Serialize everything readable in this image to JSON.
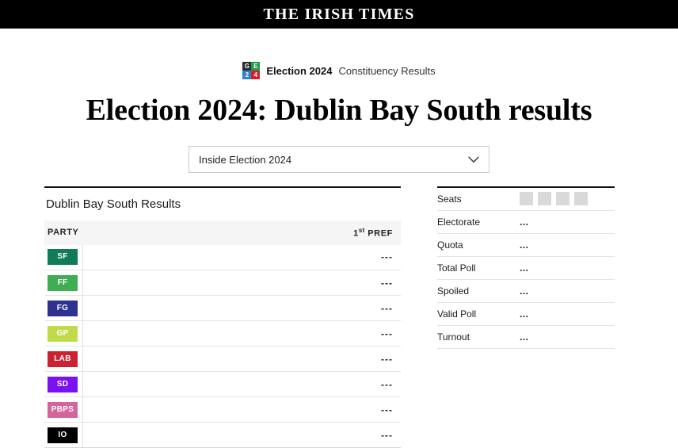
{
  "masthead": {
    "title": "THE IRISH TIMES"
  },
  "eyebrow": {
    "logo": {
      "name": "ge24-logo",
      "cells": [
        {
          "text": "G",
          "color": "#2b2b2b"
        },
        {
          "text": "E",
          "color": "#1f9d4d"
        },
        {
          "text": "2",
          "color": "#2b7fd4"
        },
        {
          "text": "4",
          "color": "#d4202c"
        }
      ]
    },
    "strong": "Election 2024",
    "light": "Constituency Results"
  },
  "page_title": "Election 2024: Dublin Bay South results",
  "selector": {
    "value": "Inside Election 2024",
    "icon": "chevron-down-icon"
  },
  "results": {
    "heading": "Dublin Bay South Results",
    "columns": {
      "party": "PARTY",
      "pref_number": "1",
      "pref_suffix": "st",
      "pref_label": "PREF"
    },
    "rows": [
      {
        "party": "SF",
        "color": "#0f7b57",
        "value": "---",
        "bar_pct": 0
      },
      {
        "party": "FF",
        "color": "#3fae52",
        "value": "---",
        "bar_pct": 0
      },
      {
        "party": "FG",
        "color": "#2f3191",
        "value": "---",
        "bar_pct": 0
      },
      {
        "party": "GP",
        "color": "#c2d94a",
        "value": "---",
        "bar_pct": 0
      },
      {
        "party": "LAB",
        "color": "#cc2131",
        "value": "---",
        "bar_pct": 0
      },
      {
        "party": "SD",
        "color": "#7b10f0",
        "value": "---",
        "bar_pct": 0
      },
      {
        "party": "PBPS",
        "color": "#d4649b",
        "value": "---",
        "bar_pct": 0
      },
      {
        "party": "IO",
        "color": "#000000",
        "value": "---",
        "bar_pct": 0
      }
    ]
  },
  "stats": {
    "rows": [
      {
        "label": "Seats",
        "value": "",
        "seat_boxes": 4
      },
      {
        "label": "Electorate",
        "value": "...",
        "seat_boxes": 0
      },
      {
        "label": "Quota",
        "value": "...",
        "seat_boxes": 0
      },
      {
        "label": "Total Poll",
        "value": "...",
        "seat_boxes": 0
      },
      {
        "label": "Spoiled",
        "value": "...",
        "seat_boxes": 0
      },
      {
        "label": "Valid Poll",
        "value": "...",
        "seat_boxes": 0
      },
      {
        "label": "Turnout",
        "value": "...",
        "seat_boxes": 0
      }
    ]
  }
}
